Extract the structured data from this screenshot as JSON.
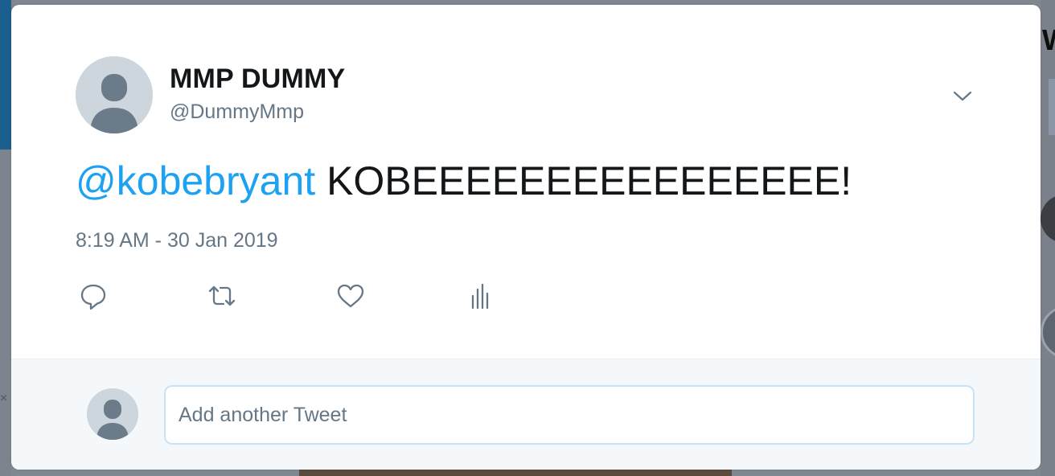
{
  "tweet": {
    "display_name": "MMP DUMMY",
    "handle": "@DummyMmp",
    "mention": "@kobebryant",
    "body": "KOBEEEEEEEEEEEEEEEE!",
    "timestamp": "8:19 AM - 30 Jan 2019"
  },
  "actions": {
    "reply_icon": "reply-icon",
    "retweet_icon": "retweet-icon",
    "like_icon": "heart-icon",
    "analytics_icon": "analytics-icon"
  },
  "reply_box": {
    "placeholder": "Add another Tweet",
    "value": ""
  },
  "colors": {
    "accent": "#1da1f2",
    "text": "#14171a",
    "secondary_text": "#657786",
    "footer_bg": "#f5f8fa",
    "input_border": "#c8e3f7",
    "avatar_bg": "#cdd6dd",
    "avatar_fg": "#6b7b8a"
  }
}
